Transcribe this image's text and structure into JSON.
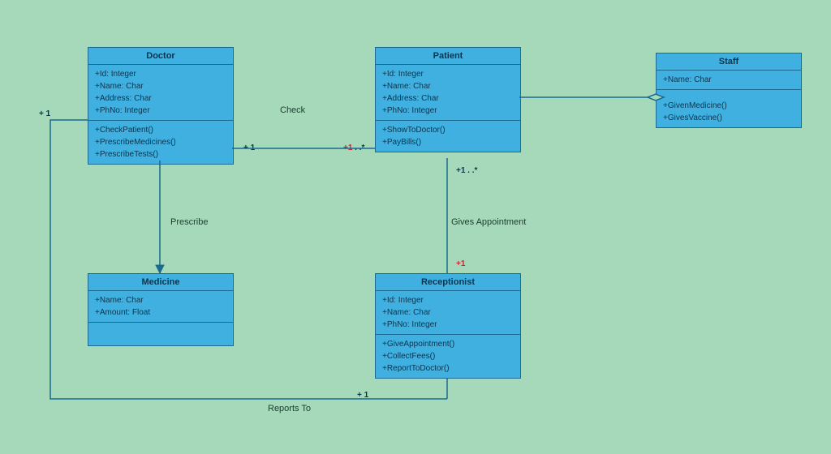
{
  "classes": {
    "doctor": {
      "title": "Doctor",
      "attrs": [
        "+Id: Integer",
        "+Name: Char",
        "+Address: Char",
        "+PhNo: Integer"
      ],
      "ops": [
        "+CheckPatient()",
        "+PrescribeMedicines()",
        "+PrescribeTests()"
      ]
    },
    "patient": {
      "title": "Patient",
      "attrs": [
        "+Id: Integer",
        "+Name: Char",
        "+Address: Char",
        "+PhNo: Integer"
      ],
      "ops": [
        "+ShowToDoctor()",
        "+PayBills()"
      ]
    },
    "staff": {
      "title": "Staff",
      "attrs": [
        "+Name: Char"
      ],
      "ops": [
        "+GivenMedicine()",
        "+GivesVaccine()"
      ]
    },
    "medicine": {
      "title": "Medicine",
      "attrs": [
        "+Name: Char",
        "+Amount: Float"
      ],
      "ops": []
    },
    "receptionist": {
      "title": "Receptionist",
      "attrs": [
        "+Id: Integer",
        "+Name: Char",
        "+PhNo: Integer"
      ],
      "ops": [
        "+GiveAppointment()",
        "+CollectFees()",
        "+ReportToDoctor()"
      ]
    }
  },
  "labels": {
    "check": "Check",
    "prescribe": "Prescribe",
    "givesAppointment": "Gives Appointment",
    "reportsTo": "Reports To"
  },
  "mult": {
    "doctor_check": "+ 1",
    "patient_check": "+1 . .*",
    "patient_appt": "+1 . .*",
    "receptionist_appt": "+1",
    "receptionist_reports": "+ 1",
    "doctor_reports": "+ 1"
  }
}
